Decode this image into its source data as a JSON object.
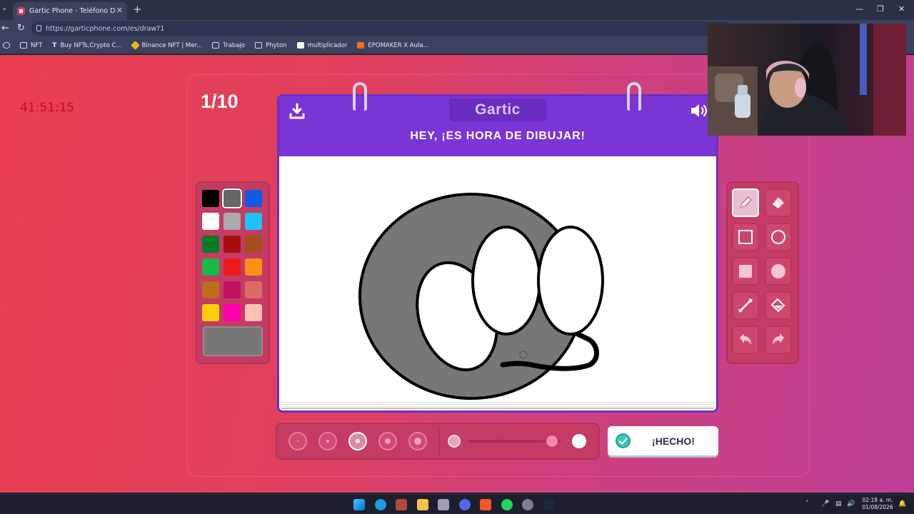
{
  "browser": {
    "tab_title": "Gartic Phone - Teléfono Descompuesto",
    "url": "https://garticphone.com/es/draw?1",
    "bookmarks": [
      "NFT",
      "Buy NFTs,Crypto C...",
      "Binance NFT | Mer...",
      "Trabajo",
      "Phyton",
      "multiplicador",
      "EPOMAKER X Aula..."
    ]
  },
  "overlay": {
    "timer": "41:51:15"
  },
  "game": {
    "round": "1/10",
    "brand": "Gartic",
    "prompt": "HEY, ¡ES HORA DE DIBUJAR!",
    "done_label": "¡HECHO!",
    "palette": [
      "#000000",
      "#666666",
      "#0f5ae6",
      "#ffffff",
      "#aaaaaa",
      "#1fc2f7",
      "#0a7a25",
      "#a60e0e",
      "#a3501c",
      "#17b84b",
      "#ee1a1a",
      "#f7911a",
      "#b96e17",
      "#c1105f",
      "#d96d63",
      "#fccf0a",
      "#ff00aa",
      "#ffc2b2"
    ],
    "selected_color": "#666666",
    "current_color": "#777777",
    "tools": [
      "pencil-icon",
      "eraser-icon",
      "rectangle-outline-icon",
      "ellipse-outline-icon",
      "rectangle-filled-icon",
      "ellipse-filled-icon",
      "line-icon",
      "fill-bucket-icon",
      "undo-icon",
      "redo-icon"
    ],
    "active_tool": "pencil-icon",
    "brush_sizes": 5,
    "selected_brush_size": 3,
    "opacity_level": 0.9
  },
  "taskbar": {
    "time": "02:18 a. m.",
    "date": "01/08/2026"
  }
}
